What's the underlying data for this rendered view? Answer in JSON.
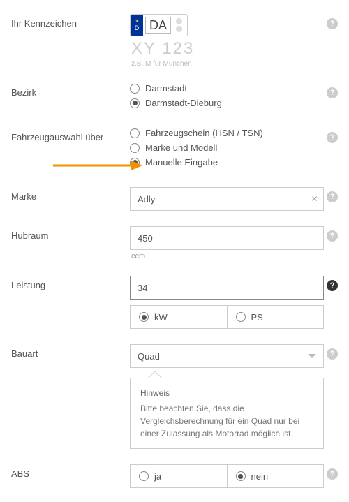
{
  "kennzeichen": {
    "label": "Ihr Kennzeichen",
    "eu_letter": "D",
    "value": "DA",
    "ghost": "XY 123",
    "hint": "z.B. M für München"
  },
  "bezirk": {
    "label": "Bezirk",
    "options": [
      "Darmstadt",
      "Darmstadt-Dieburg"
    ],
    "selected": 1
  },
  "fahrzeugauswahl": {
    "label": "Fahrzeugauswahl über",
    "options": [
      "Fahrzeugschein (HSN / TSN)",
      "Marke und Modell",
      "Manuelle Eingabe"
    ],
    "selected": 2
  },
  "marke": {
    "label": "Marke",
    "value": "Adly"
  },
  "hubraum": {
    "label": "Hubraum",
    "value": "450",
    "unit": "ccm"
  },
  "leistung": {
    "label": "Leistung",
    "value": "34",
    "units": [
      "kW",
      "PS"
    ],
    "unit_selected": 0
  },
  "bauart": {
    "label": "Bauart",
    "value": "Quad",
    "hint_title": "Hinweis",
    "hint_text": "Bitte beachten Sie, dass die Vergleichsberechnung für ein Quad nur bei einer Zulassung als Motorrad möglich ist."
  },
  "abs": {
    "label": "ABS",
    "options": [
      "ja",
      "nein"
    ],
    "selected": 1
  }
}
